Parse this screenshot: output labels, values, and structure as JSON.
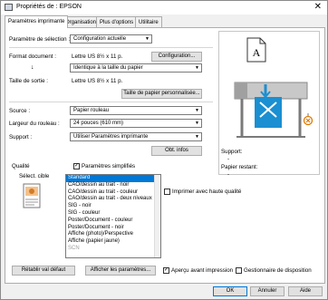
{
  "window": {
    "title": "Propriétés de : EPSON"
  },
  "tabs": [
    "Paramètres imprimante",
    "Organisation",
    "Plus d'options",
    "Utilitaire"
  ],
  "form": {
    "selection_label": "Paramètre de sélection :",
    "selection_value": "Configuration actuelle",
    "document_format_label": "Format document :",
    "document_format_value": "Lettre US 8½ x 11 p.",
    "config_button": "Configuration...",
    "arrow_glyph": "↓",
    "paper_size_same": "Identique à la taille du papier",
    "output_size_label": "Taille de sortie :",
    "output_size_value": "Lettre US 8½ x 11 p.",
    "custom_paper_button": "Taille de papier personnalisée...",
    "source_label": "Source :",
    "source_value": "Papier rouleau",
    "roll_width_label": "Largeur du rouleau :",
    "roll_width_value": "24 pouces (610 mm)",
    "support_label": "Support :",
    "support_value": "Utiliser Paramètres imprimante",
    "get_info_button": "Obt. infos"
  },
  "quality": {
    "label": "Qualité",
    "simplified_label": "Paramètres simplifiés",
    "simplified_checked": true,
    "target_label": "Sélect. cible",
    "items": [
      "Standard",
      "CAO/dessin au trait - noir",
      "CAO/dessin au trait - couleur",
      "CAO/dessin au trait - deux niveaux",
      "SIG - noir",
      "SIG - couleur",
      "Poster/Document - couleur",
      "Poster/Document - noir",
      "Affiche (photo)/Perspective",
      "Affiche (papier jaune)",
      "SCN"
    ],
    "selected_index": 0,
    "high_quality_label": "Imprimer avec haute qualité",
    "high_quality_checked": false
  },
  "right_panel": {
    "paper_letter": "A",
    "support_label": "Support:",
    "support_value": "-",
    "paper_left_label": "Papier restant:",
    "paper_left_value": "-"
  },
  "bottom_row": {
    "reset_button": "Rétablir val défaut",
    "show_settings_button": "Afficher les paramètres...",
    "preview_label": "Aperçu avant impression",
    "preview_checked": true,
    "layout_manager_label": "Gestionnaire de disposition",
    "layout_manager_checked": false
  },
  "dialog_buttons": {
    "ok": "OK",
    "cancel": "Annuler",
    "help": "Aide"
  },
  "colors": {
    "accent": "#0078d7",
    "printer_blue": "#1a8fd1",
    "printer_gray": "#9a9a9a"
  },
  "icons": [
    "printer-app-icon",
    "close-icon",
    "paper-icon",
    "printer-icon",
    "target-icon",
    "error-icon"
  ]
}
